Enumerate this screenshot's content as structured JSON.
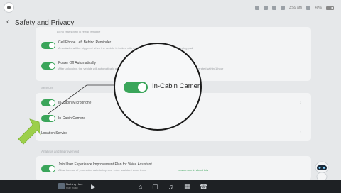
{
  "header": {
    "title": "Safety and Privacy"
  },
  "status": {
    "time_text": "3:59 am",
    "signal_text": "40%"
  },
  "rows": {
    "top_blurred_desc": "Lo no rear sot rel lk rewal remobile",
    "phone_left": {
      "title": "Cell Phone Left Behind Reminder",
      "desc": "A reminder will be triggered when the vehicle is locked with a phone left on the corresponding charging pad"
    },
    "power_off": {
      "title": "Power Off Automatically",
      "desc": "After unlocking, the vehicle will automatically power off when the driver leaves the seat and the vehicle is not operated within 1 hour"
    },
    "section_sensors": "Sensors",
    "microphone": {
      "title": "In-Cabin Microphone"
    },
    "camera": {
      "title": "In-Cabin Camera"
    },
    "location": {
      "title": "Location Service"
    },
    "section_analysis": "Analysis and Improvement",
    "experience": {
      "title": "Join User Experience Improvement Plan for Voice Assistant",
      "desc": "Allow the use of your voice data to improve voice assistant experience",
      "link": "Learn more in about this"
    }
  },
  "magnifier": {
    "label": "In-Cabin Camera"
  },
  "dock": {
    "media_title": "Nothing Here",
    "media_sub": "Play music"
  },
  "colors": {
    "toggle_on": "#3aa55a",
    "arrow": "#9ccf4a",
    "dock_bg": "#1e2124"
  },
  "icons": [
    "app-logo-icon",
    "back-chevron-icon",
    "wifi-icon",
    "bluetooth-icon",
    "battery-icon",
    "chevron-right-icon",
    "play-icon",
    "home-icon",
    "car-icon",
    "music-icon",
    "apps-icon",
    "phone-icon",
    "robot-assistant-icon",
    "arrow-pointer-icon"
  ]
}
